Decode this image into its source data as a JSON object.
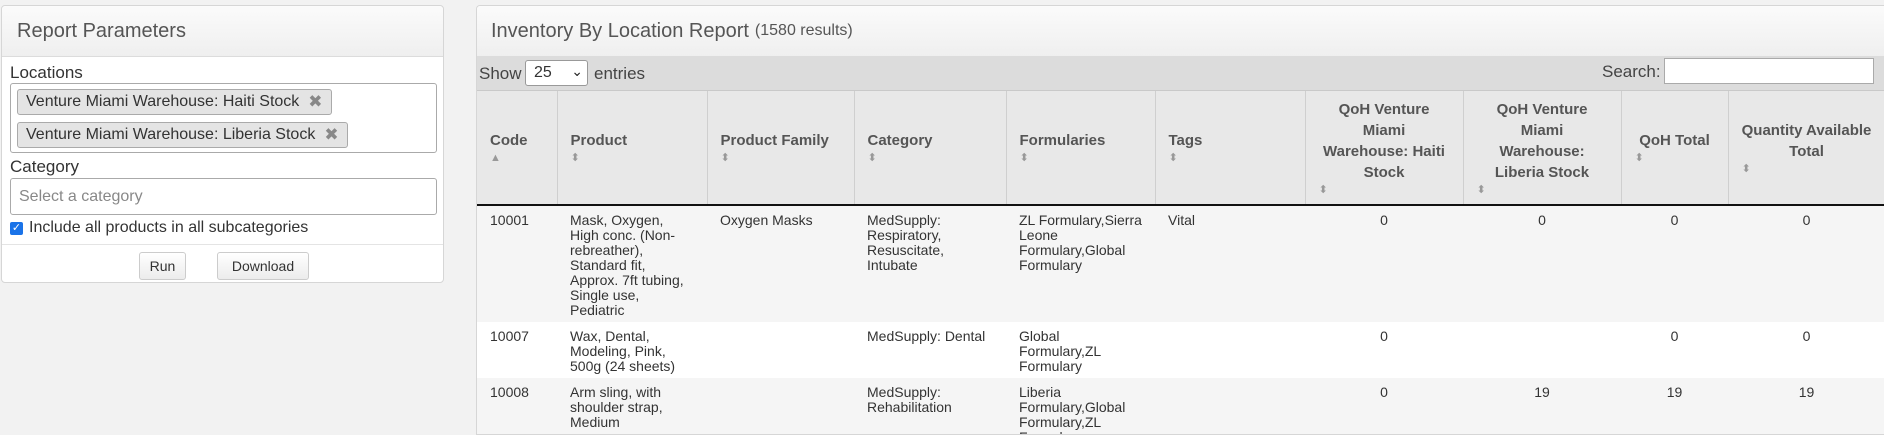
{
  "params": {
    "title": "Report Parameters",
    "locations_label": "Locations",
    "locations": [
      "Venture Miami Warehouse: Haiti Stock",
      "Venture Miami Warehouse: Liberia Stock"
    ],
    "remove_glyph": "✖",
    "category_label": "Category",
    "category_placeholder": "Select a category",
    "include_label": "Include all products in all subcategories",
    "include_checked": true,
    "run_label": "Run",
    "download_label": "Download"
  },
  "report": {
    "title": "Inventory By Location Report",
    "count": "(1580 results)",
    "show_label": "Show",
    "page_size": "25",
    "entries_label": "entries",
    "search_label": "Search:",
    "search_value": "",
    "columns": [
      "Code",
      "Product",
      "Product Family",
      "Category",
      "Formularies",
      "Tags",
      "QoH Venture Miami Warehouse: Haiti Stock",
      "QoH Venture Miami Warehouse: Liberia Stock",
      "QoH Total",
      "Quantity Available Total"
    ],
    "rows": [
      {
        "code": "10001",
        "product": "Mask, Oxygen, High conc. (Non-rebreather), Standard fit, Approx. 7ft tubing, Single use, Pediatric",
        "family": "Oxygen Masks",
        "category": "MedSupply: Respiratory, Resuscitate, Intubate",
        "formularies": "ZL Formulary,Sierra Leone Formulary,Global Formulary",
        "tags": "Vital",
        "qoh_haiti": "0",
        "qoh_liberia": "0",
        "qoh_total": "0",
        "qty_available": "0"
      },
      {
        "code": "10007",
        "product": "Wax, Dental, Modeling, Pink, 500g (24 sheets)",
        "family": "",
        "category": "MedSupply: Dental",
        "formularies": "Global Formulary,ZL Formulary",
        "tags": "",
        "qoh_haiti": "0",
        "qoh_liberia": "",
        "qoh_total": "0",
        "qty_available": "0"
      },
      {
        "code": "10008",
        "product": "Arm sling, with shoulder strap, Medium",
        "family": "",
        "category": "MedSupply: Rehabilitation",
        "formularies": "Liberia Formulary,Global Formulary,ZL Formulary",
        "tags": "",
        "qoh_haiti": "0",
        "qoh_liberia": "19",
        "qoh_total": "19",
        "qty_available": "19"
      }
    ]
  },
  "icons": {
    "sort_asc": "▲",
    "sort_both": "⬍",
    "checkbox": "✓",
    "select_chevron": "⌄"
  }
}
